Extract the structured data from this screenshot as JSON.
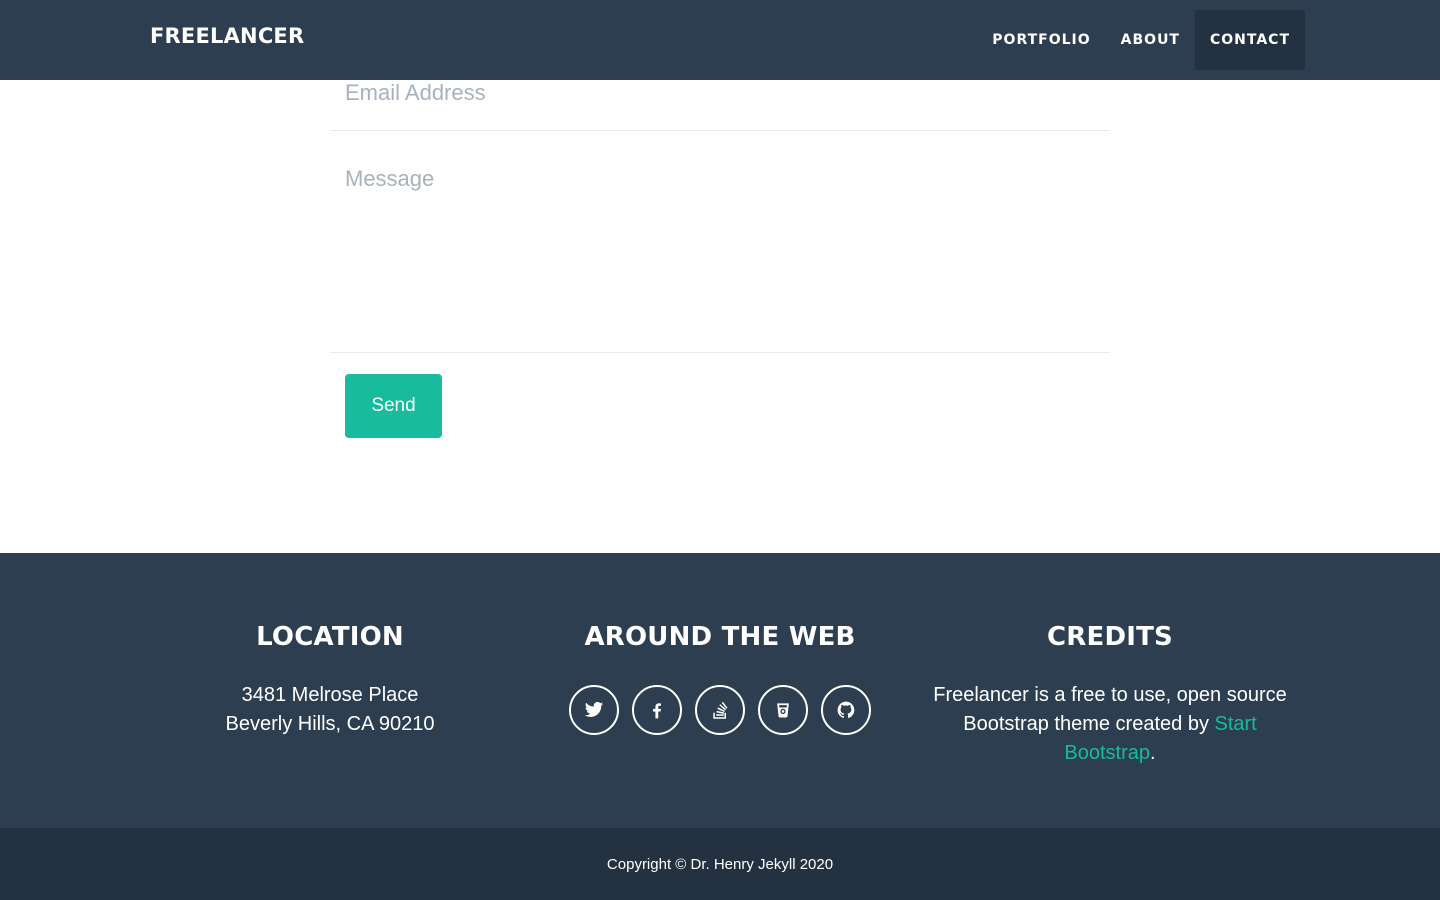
{
  "nav": {
    "brand": "FREELANCER",
    "links": [
      {
        "label": "PORTFOLIO"
      },
      {
        "label": "ABOUT"
      },
      {
        "label": "CONTACT",
        "active": true
      }
    ]
  },
  "form": {
    "email_placeholder": "Email Address",
    "message_placeholder": "Message",
    "send_label": "Send"
  },
  "footer": {
    "location": {
      "heading": "LOCATION",
      "line1": "3481 Melrose Place",
      "line2": "Beverly Hills, CA 90210"
    },
    "web": {
      "heading": "AROUND THE WEB",
      "icons": [
        "twitter-icon",
        "facebook-icon",
        "stack-overflow-icon",
        "untappd-icon",
        "github-icon"
      ]
    },
    "credits": {
      "heading": "CREDITS",
      "text_before": "Freelancer is a free to use, open source Bootstrap theme created by ",
      "link_text": "Start Bootstrap",
      "text_after": "."
    }
  },
  "copyright": "Copyright © Dr. Henry Jekyll 2020",
  "colors": {
    "primary_dark": "#2c3e50",
    "darker": "#233140",
    "accent": "#18bc9c"
  }
}
